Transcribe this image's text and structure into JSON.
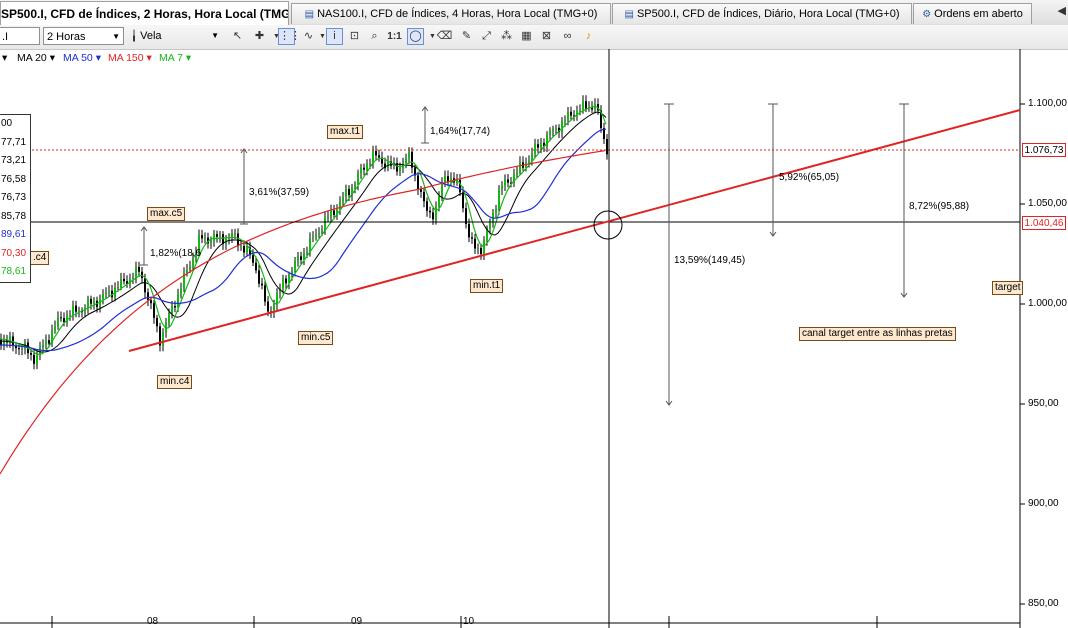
{
  "tabs": [
    {
      "label": "SP500.I, CFD de Índices, 2 Horas, Hora Local (TMG+0)",
      "icon": "chart-icon",
      "active": true
    },
    {
      "label": "NAS100.I, CFD de Índices, 4 Horas, Hora Local (TMG+0)",
      "icon": "chart-icon",
      "active": false
    },
    {
      "label": "SP500.I, CFD de Índices, Diário, Hora Local (TMG+0)",
      "icon": "chart-icon",
      "active": false
    },
    {
      "label": "Ordens em aberto",
      "icon": "orders-icon",
      "active": false
    }
  ],
  "toolbar": {
    "symbol_value": ".I",
    "timeframe_value": "2 Horas",
    "chart_type_value": "Vela",
    "one_to_one_label": "1:1"
  },
  "indicators": [
    {
      "label": "MA 20",
      "color": "#000000"
    },
    {
      "label": "MA 50",
      "color": "#1f2fd6"
    },
    {
      "label": "MA 150",
      "color": "#e02424"
    },
    {
      "label": "MA 7",
      "color": "#17b617"
    }
  ],
  "value_box": [
    "00",
    "77,71",
    "73,21",
    "76,58",
    "76,73",
    "85,78",
    "89,61",
    "70,30",
    "78,61"
  ],
  "value_box_colors": [
    "#000000",
    "#000000",
    "#000000",
    "#000000",
    "#000000",
    "#000000",
    "#1f2fd6",
    "#e02424",
    "#17b617"
  ],
  "annotations": {
    "max_t1": "max.t1",
    "max_c5": "max.c5",
    "min_c4": "min.c4",
    "min_c5": "min.c5",
    "min_t1": "min.t1",
    "c4_partial": ".c4",
    "target_partial": "target",
    "pct_1_64": "1,64%(17,74)",
    "pct_3_61": "3,61%(37,59)",
    "pct_1_82": "1,82%(18,6",
    "pct_13_59": "13,59%(149,45)",
    "pct_5_92": "5,92%(65,05)",
    "pct_8_72": "8,72%(95,88)",
    "channel_note": "canal target entre as linhas pretas"
  },
  "price_axis": [
    "1.100,00",
    "1.050,00",
    "1.000,00",
    "950,00",
    "900,00",
    "850,00"
  ],
  "price_markers": {
    "current": "1.076,73",
    "line": "1.040,46"
  },
  "date_labels": [
    "08",
    "09",
    "10"
  ],
  "colors": {
    "bull": "#17b617",
    "bear": "#000000",
    "ma20": "#000000",
    "ma50": "#1f2fd6",
    "ma150": "#e02424",
    "trendline": "#e02424"
  }
}
